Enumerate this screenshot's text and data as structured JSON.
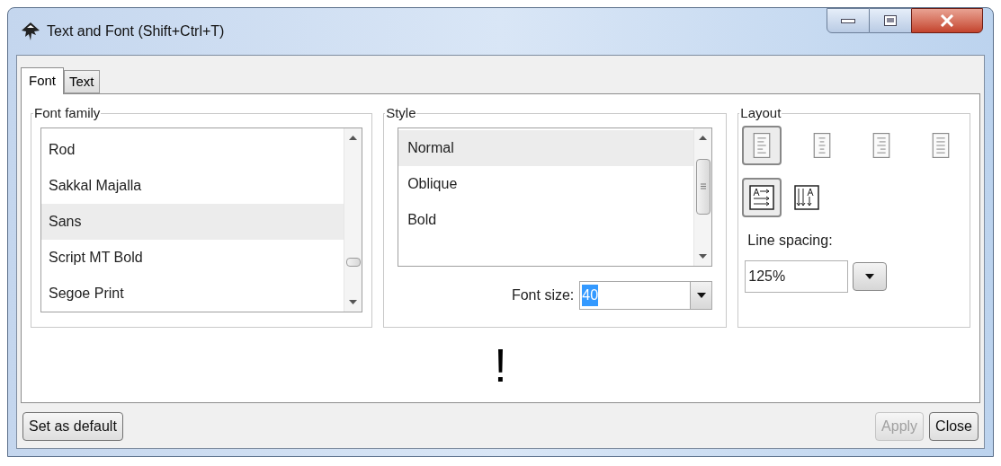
{
  "window": {
    "title": "Text and Font (Shift+Ctrl+T)"
  },
  "tabs": [
    {
      "label": "Font",
      "selected": true
    },
    {
      "label": "Text",
      "selected": false
    }
  ],
  "font_family": {
    "label": "Font family",
    "items": [
      {
        "label": "Rod",
        "selected": false
      },
      {
        "label": "Sakkal Majalla",
        "selected": false
      },
      {
        "label": "Sans",
        "selected": true
      },
      {
        "label": "Script MT Bold",
        "selected": false
      },
      {
        "label": "Segoe Print",
        "selected": false
      }
    ]
  },
  "style": {
    "label": "Style",
    "items": [
      {
        "label": "Normal",
        "selected": true
      },
      {
        "label": "Oblique",
        "selected": false
      },
      {
        "label": "Bold",
        "selected": false
      }
    ],
    "font_size": {
      "label": "Font size:",
      "value": "40"
    }
  },
  "layout": {
    "label": "Layout",
    "alignment": [
      {
        "kind": "left",
        "selected": true
      },
      {
        "kind": "center",
        "selected": false
      },
      {
        "kind": "right",
        "selected": false
      },
      {
        "kind": "justify",
        "selected": false
      }
    ],
    "orientation": [
      {
        "kind": "horizontal",
        "selected": true
      },
      {
        "kind": "vertical",
        "selected": false
      }
    ],
    "line_spacing": {
      "label": "Line spacing:",
      "value": "125%"
    }
  },
  "preview": {
    "text": "!"
  },
  "buttons": [
    {
      "label": "Set as default",
      "disabled": false
    },
    {
      "label": "Apply",
      "disabled": true
    },
    {
      "label": "Close",
      "disabled": false
    }
  ]
}
